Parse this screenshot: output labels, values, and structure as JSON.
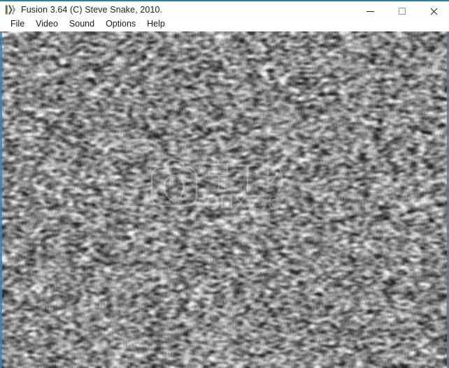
{
  "window": {
    "title": "Fusion 3.64 (C) Steve Snake, 2010.",
    "app_icon": "kega-fusion-logo-icon",
    "accent_color": "#3d7a96",
    "titlebar_background": "#fdffff",
    "controls": [
      {
        "name": "minimize",
        "label": "—",
        "icon": "minimize-icon"
      },
      {
        "name": "maximize",
        "label": "□",
        "icon": "maximize-icon"
      },
      {
        "name": "close",
        "label": "✕",
        "icon": "close-icon"
      }
    ]
  },
  "menu": {
    "items": [
      {
        "id": "file",
        "label": "File"
      },
      {
        "id": "video",
        "label": "Video"
      },
      {
        "id": "sound",
        "label": "Sound"
      },
      {
        "id": "options",
        "label": "Options"
      },
      {
        "id": "help",
        "label": "Help"
      }
    ]
  },
  "video": {
    "content": "static-noise",
    "description": "Grayscale analog TV static / snow fills the emulator display area",
    "border_color": "#4b7fa5",
    "noise_tone_low": "#3b3b3b",
    "noise_tone_high": "#f2f2f2"
  },
  "watermark": {
    "icon": "bag-logo-icon",
    "text_cn": "安下载",
    "text_url": "anxz.com",
    "opacity": "0.42"
  }
}
